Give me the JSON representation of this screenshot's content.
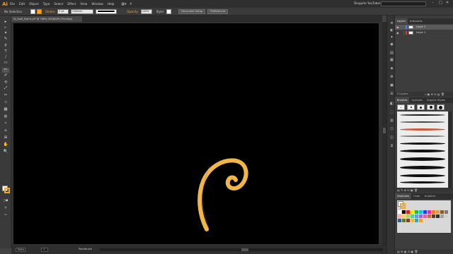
{
  "app": {
    "logo": "Ai",
    "menus": [
      "File",
      "Edit",
      "Object",
      "Type",
      "Select",
      "Effect",
      "View",
      "Window",
      "Help"
    ],
    "workspace": "Dieguito YouTuber",
    "window_controls": [
      "–",
      "□",
      "✕"
    ]
  },
  "control_bar": {
    "selection": "No Selection",
    "stroke_label": "Stroke:",
    "stroke_weight": "5 pt",
    "brush_profile": "Uniform",
    "opacity_label": "Opacity:",
    "opacity_value": "100%",
    "style_label": "Style:",
    "doc_setup": "Document Setup",
    "preferences": "Preferences",
    "colors": {
      "stroke": "#f5a623",
      "accent": "#f0a030"
    }
  },
  "document": {
    "tab_title": "Ill_Gold_Swirls.ai* @ 768% (RGB/GPU Preview)",
    "zoom": "768%",
    "page": "1",
    "status": "Paintbrush"
  },
  "tools": [
    "▸",
    "▹",
    "✦",
    "✎",
    "P",
    "T",
    "/",
    "▭",
    "✏",
    "✐",
    "⟲",
    "⤢",
    "✂",
    "⊹",
    "▦",
    "◍",
    "✧",
    "⌂",
    "⊞",
    "✋",
    "🔍"
  ],
  "dock_icons": [
    "≡",
    "◐",
    "✦",
    "◉",
    "▤",
    "▦",
    "◈",
    "⚙",
    "▣",
    "☰",
    "◧",
    "⬚",
    "▥",
    "⬡",
    "◫",
    "⌸"
  ],
  "layers_panel": {
    "tabs": [
      "Layers",
      "Artboards"
    ],
    "layers": [
      {
        "name": "Layer 2",
        "color": "#4f7bff",
        "selected": true
      },
      {
        "name": "Layer 1",
        "color": "#e23b3b",
        "selected": false
      }
    ],
    "footer": "2 Layers"
  },
  "brushes_panel": {
    "tabs": [
      "Brushes",
      "Symbols",
      "Graphic Styles"
    ]
  },
  "swatches_panel": {
    "tabs": [
      "Swatches",
      "Color",
      "Gradient"
    ]
  }
}
